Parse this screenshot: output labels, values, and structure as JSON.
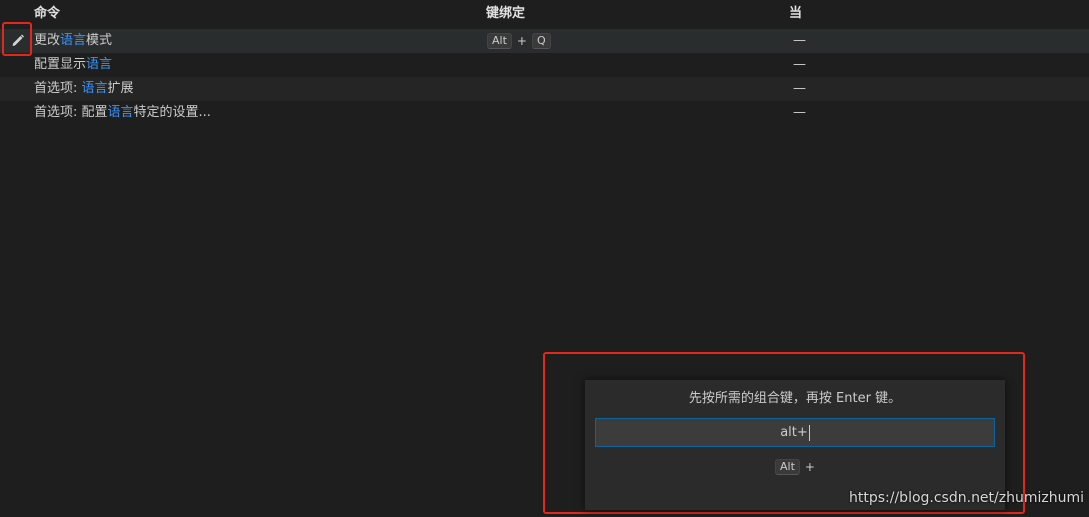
{
  "table": {
    "headers": {
      "command": "命令",
      "keybinding": "键绑定",
      "when": "当"
    },
    "rows": [
      {
        "command_parts": [
          "更改",
          "语言",
          "模式"
        ],
        "keybinding": [
          "Alt",
          "+",
          "Q"
        ],
        "when": "—"
      },
      {
        "command_parts": [
          "配置显示",
          "语言",
          ""
        ],
        "keybinding": [],
        "when": "—"
      },
      {
        "command_parts": [
          "首选项: ",
          "语言",
          "扩展"
        ],
        "keybinding": [],
        "when": "—"
      },
      {
        "command_parts": [
          "首选项: 配置",
          "语言",
          "特定的设置..."
        ],
        "keybinding": [],
        "when": "—"
      }
    ]
  },
  "icons": {
    "edit": "pencil-icon"
  },
  "dialog": {
    "message": "先按所需的组合键，再按 Enter 键。",
    "input_value": "alt+",
    "preview": [
      "Alt",
      "+"
    ]
  },
  "watermark": "https://blog.csdn.net/zhumizhumi",
  "colors": {
    "highlight": "#3794ff",
    "annotation": "#e3271d",
    "input_border": "#0e639c"
  }
}
